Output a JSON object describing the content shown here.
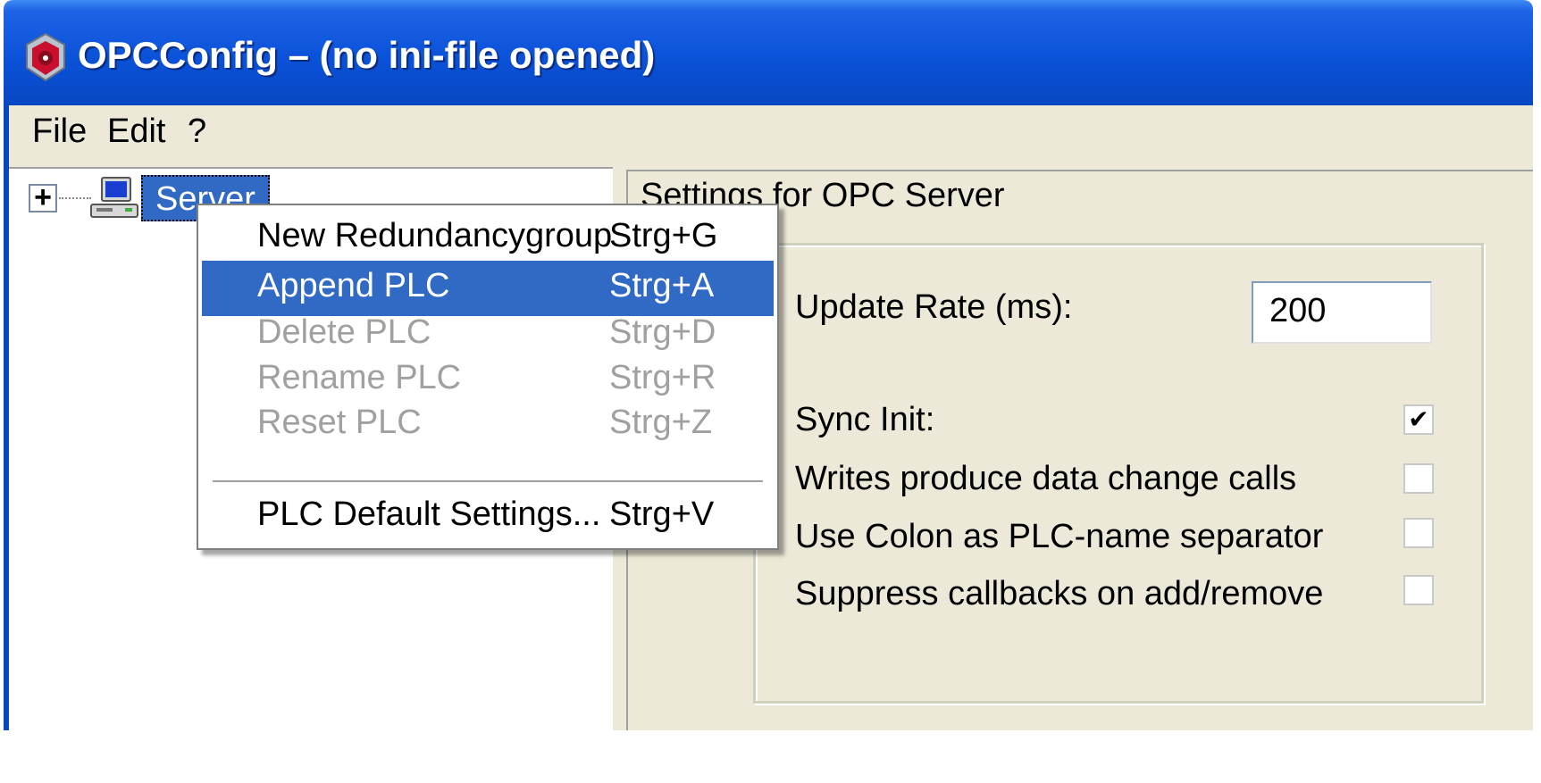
{
  "window": {
    "title": "OPCConfig – (no ini-file opened)",
    "icon": "opcconfig-app-icon"
  },
  "menubar": {
    "items": [
      "File",
      "Edit",
      "?"
    ]
  },
  "tree": {
    "expander_symbol": "+",
    "root": {
      "label": "Server",
      "icon": "computer-icon",
      "selected": true
    }
  },
  "context_menu": {
    "items": [
      {
        "label": "New Redundancygroup",
        "shortcut": "Strg+G",
        "state": "enabled"
      },
      {
        "label": "Append PLC",
        "shortcut": "Strg+A",
        "state": "highlighted"
      },
      {
        "label": "Delete PLC",
        "shortcut": "Strg+D",
        "state": "disabled"
      },
      {
        "label": "Rename PLC",
        "shortcut": "Strg+R",
        "state": "disabled"
      },
      {
        "label": "Reset PLC",
        "shortcut": "Strg+Z",
        "state": "disabled"
      }
    ],
    "footer_item": {
      "label": "PLC Default Settings...",
      "shortcut": "Strg+V",
      "state": "enabled"
    }
  },
  "settings": {
    "title": "Settings for OPC Server",
    "update_rate_label": "Update Rate (ms):",
    "update_rate_value": "200",
    "options": [
      {
        "label": "Sync Init:",
        "checked": true
      },
      {
        "label": "Writes produce data change calls",
        "checked": false
      },
      {
        "label": "Use Colon as PLC-name separator",
        "checked": false
      },
      {
        "label": "Suppress callbacks on add/remove",
        "checked": false
      }
    ]
  },
  "colors": {
    "titlebar": "#0a52d9",
    "selection": "#316ac5",
    "window_bg": "#ece9d8",
    "disabled_text": "#a0a0a0"
  }
}
